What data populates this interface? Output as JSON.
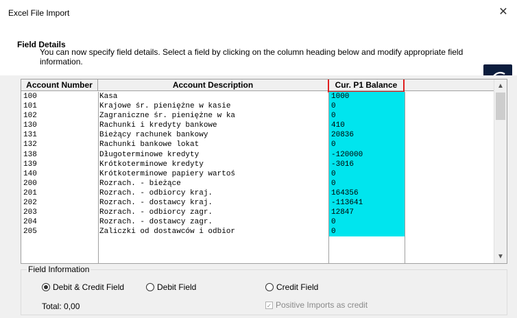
{
  "window": {
    "title": "Excel File Import",
    "close_glyph": "✕"
  },
  "header": {
    "title": "Field Details",
    "description": "You can now specify field details. Select a field by clicking on the column heading below and modify appropriate field information.",
    "logo_icon": "curved-arrow-icon"
  },
  "table": {
    "columns": [
      "Account Number",
      "Account Description",
      "Cur. P1 Balance"
    ],
    "highlighted_column": "Cur. P1 Balance",
    "highlight_color": "#00e5ee",
    "rows": [
      {
        "account": "100",
        "description": "Kasa",
        "balance": "1000"
      },
      {
        "account": "101",
        "description": "Krajowe śr. pieniężne w kasie",
        "balance": "0"
      },
      {
        "account": "102",
        "description": "Zagraniczne śr. pieniężne w ka",
        "balance": "0"
      },
      {
        "account": "130",
        "description": "Rachunki i kredyty bankowe",
        "balance": "410"
      },
      {
        "account": "131",
        "description": "Bieżący rachunek bankowy",
        "balance": "20836"
      },
      {
        "account": "132",
        "description": "Rachunki bankowe lokat",
        "balance": "0"
      },
      {
        "account": "138",
        "description": "Długoterminowe kredyty",
        "balance": "-120000"
      },
      {
        "account": "139",
        "description": "Krótkoterminowe kredyty",
        "balance": "-3016"
      },
      {
        "account": "140",
        "description": "Krótkoterminowe papiery wartoś",
        "balance": "0"
      },
      {
        "account": "200",
        "description": "Rozrach. - bieżące",
        "balance": "0"
      },
      {
        "account": "201",
        "description": "Rozrach. - odbiorcy kraj.",
        "balance": "164356"
      },
      {
        "account": "202",
        "description": "Rozrach. - dostawcy kraj.",
        "balance": "-113641"
      },
      {
        "account": "203",
        "description": "Rozrach. - odbiorcy zagr.",
        "balance": "12847"
      },
      {
        "account": "204",
        "description": "Rozrach. - dostawcy zagr.",
        "balance": "0"
      },
      {
        "account": "205",
        "description": "Zaliczki od dostawców i odbior",
        "balance": "0"
      }
    ]
  },
  "field_info": {
    "title": "Field Information",
    "options": [
      {
        "label": "Debit & Credit Field",
        "selected": true
      },
      {
        "label": "Debit Field",
        "selected": false
      },
      {
        "label": "Credit Field",
        "selected": false
      }
    ],
    "total": "Total: 0,00",
    "positive_imports_label": "Positive Imports as credit",
    "positive_imports_checked": true,
    "positive_imports_enabled": false
  }
}
